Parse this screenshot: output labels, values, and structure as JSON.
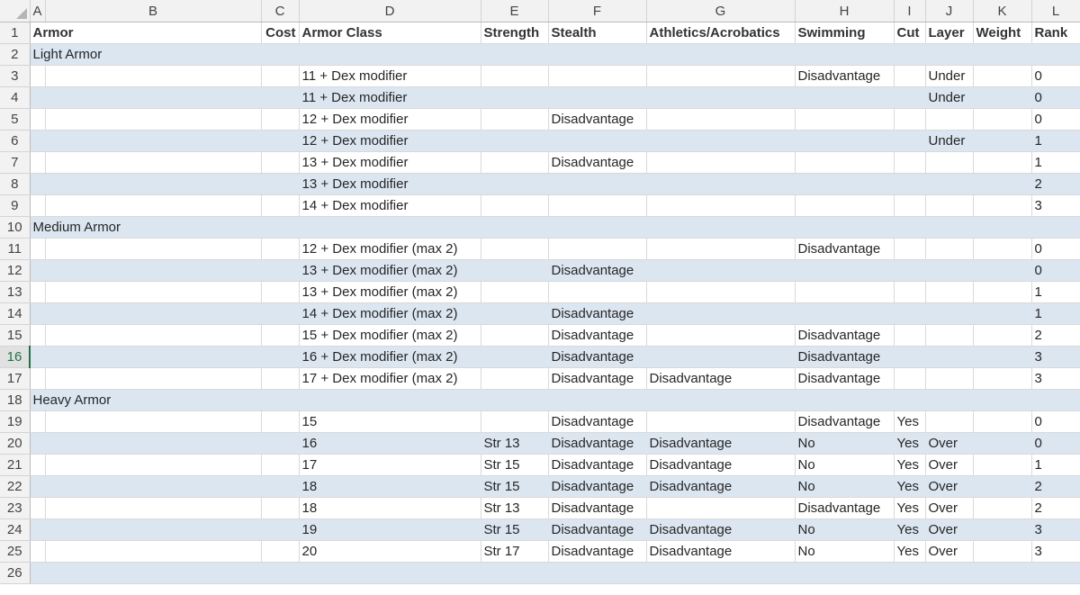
{
  "columns": [
    "A",
    "B",
    "C",
    "D",
    "E",
    "F",
    "G",
    "H",
    "I",
    "J",
    "K",
    "L"
  ],
  "headers": [
    "Armor",
    "Cost",
    "Armor Class",
    "Strength",
    "Stealth",
    "Athletics/Acrobatics",
    "Swimming",
    "Cut",
    "Layer",
    "Weight",
    "Rank"
  ],
  "active_row": "16",
  "rows": [
    {
      "type": "section",
      "label": "Light Armor"
    },
    {
      "ac": "11 + Dex modifier",
      "strength": "",
      "stealth": "",
      "athletics": "",
      "swimming": "Disadvantage",
      "cut": "",
      "layer": "Under",
      "weight": "",
      "rank": "0"
    },
    {
      "ac": "11 + Dex modifier",
      "strength": "",
      "stealth": "",
      "athletics": "",
      "swimming": "",
      "cut": "",
      "layer": "Under",
      "weight": "",
      "rank": "0"
    },
    {
      "ac": "12 + Dex modifier",
      "strength": "",
      "stealth": "Disadvantage",
      "athletics": "",
      "swimming": "",
      "cut": "",
      "layer": "",
      "weight": "",
      "rank": "0"
    },
    {
      "ac": "12 + Dex modifier",
      "strength": "",
      "stealth": "",
      "athletics": "",
      "swimming": "",
      "cut": "",
      "layer": "Under",
      "weight": "",
      "rank": "1"
    },
    {
      "ac": "13 + Dex modifier",
      "strength": "",
      "stealth": "Disadvantage",
      "athletics": "",
      "swimming": "",
      "cut": "",
      "layer": "",
      "weight": "",
      "rank": "1"
    },
    {
      "ac": "13 + Dex modifier",
      "strength": "",
      "stealth": "",
      "athletics": "",
      "swimming": "",
      "cut": "",
      "layer": "",
      "weight": "",
      "rank": "2"
    },
    {
      "ac": "14 + Dex modifier",
      "strength": "",
      "stealth": "",
      "athletics": "",
      "swimming": "",
      "cut": "",
      "layer": "",
      "weight": "",
      "rank": "3"
    },
    {
      "type": "section",
      "label": "Medium Armor"
    },
    {
      "ac": "12 + Dex modifier (max 2)",
      "strength": "",
      "stealth": "",
      "athletics": "",
      "swimming": "Disadvantage",
      "cut": "",
      "layer": "",
      "weight": "",
      "rank": "0"
    },
    {
      "ac": "13 + Dex modifier (max 2)",
      "strength": "",
      "stealth": "Disadvantage",
      "athletics": "",
      "swimming": "",
      "cut": "",
      "layer": "",
      "weight": "",
      "rank": "0"
    },
    {
      "ac": "13 + Dex modifier (max 2)",
      "strength": "",
      "stealth": "",
      "athletics": "",
      "swimming": "",
      "cut": "",
      "layer": "",
      "weight": "",
      "rank": "1"
    },
    {
      "ac": "14 + Dex modifier (max 2)",
      "strength": "",
      "stealth": "Disadvantage",
      "athletics": "",
      "swimming": "",
      "cut": "",
      "layer": "",
      "weight": "",
      "rank": "1"
    },
    {
      "ac": "15 + Dex modifier (max 2)",
      "strength": "",
      "stealth": "Disadvantage",
      "athletics": "",
      "swimming": "Disadvantage",
      "cut": "",
      "layer": "",
      "weight": "",
      "rank": "2"
    },
    {
      "ac": "16 + Dex modifier (max 2)",
      "strength": "",
      "stealth": "Disadvantage",
      "athletics": "",
      "swimming": "Disadvantage",
      "cut": "",
      "layer": "",
      "weight": "",
      "rank": "3"
    },
    {
      "ac": "17 + Dex modifier (max 2)",
      "strength": "",
      "stealth": "Disadvantage",
      "athletics": "Disadvantage",
      "swimming": "Disadvantage",
      "cut": "",
      "layer": "",
      "weight": "",
      "rank": "3"
    },
    {
      "type": "section",
      "label": "Heavy Armor"
    },
    {
      "ac": "15",
      "strength": "",
      "stealth": "Disadvantage",
      "athletics": "",
      "swimming": "Disadvantage",
      "cut": "Yes",
      "layer": "",
      "weight": "",
      "rank": "0"
    },
    {
      "ac": "16",
      "strength": "Str 13",
      "stealth": "Disadvantage",
      "athletics": "Disadvantage",
      "swimming": "No",
      "cut": "Yes",
      "layer": "Over",
      "weight": "",
      "rank": "0"
    },
    {
      "ac": "17",
      "strength": "Str 15",
      "stealth": "Disadvantage",
      "athletics": "Disadvantage",
      "swimming": "No",
      "cut": "Yes",
      "layer": "Over",
      "weight": "",
      "rank": "1"
    },
    {
      "ac": "18",
      "strength": "Str 15",
      "stealth": "Disadvantage",
      "athletics": "Disadvantage",
      "swimming": "No",
      "cut": "Yes",
      "layer": "Over",
      "weight": "",
      "rank": "2"
    },
    {
      "ac": "18",
      "strength": "Str 13",
      "stealth": "Disadvantage",
      "athletics": "",
      "swimming": "Disadvantage",
      "cut": "Yes",
      "layer": "Over",
      "weight": "",
      "rank": "2"
    },
    {
      "ac": "19",
      "strength": "Str 15",
      "stealth": "Disadvantage",
      "athletics": "Disadvantage",
      "swimming": "No",
      "cut": "Yes",
      "layer": "Over",
      "weight": "",
      "rank": "3"
    },
    {
      "ac": "20",
      "strength": "Str 17",
      "stealth": "Disadvantage",
      "athletics": "Disadvantage",
      "swimming": "No",
      "cut": "Yes",
      "layer": "Over",
      "weight": "",
      "rank": "3"
    },
    {
      "type": "empty"
    }
  ]
}
